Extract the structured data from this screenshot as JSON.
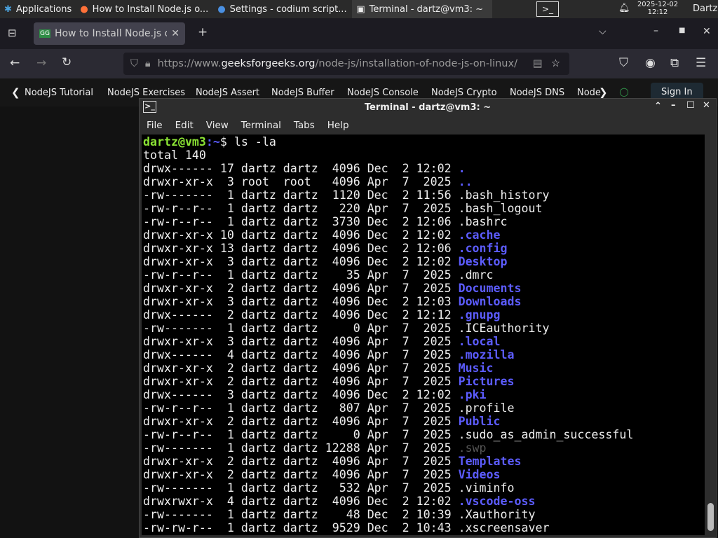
{
  "panel": {
    "apps": "Applications",
    "tasks": [
      "How to Install Node.js o...",
      "Settings - codium script...",
      "Terminal - dartz@vm3: ~"
    ],
    "date": "2025-12-02",
    "time": "12:12",
    "user": "Dartz"
  },
  "browser": {
    "tab_title": "How to Install Node.js on",
    "url_prefix": "https://www.",
    "url_domain": "geeksforgeeks.org",
    "url_path": "/node-js/installation-of-node-js-on-linux/",
    "site_nav": [
      "NodeJS Tutorial",
      "NodeJS Exercises",
      "NodeJS Assert",
      "NodeJS Buffer",
      "NodeJS Console",
      "NodeJS Crypto",
      "NodeJS DNS",
      "Node"
    ],
    "sign_in": "Sign In"
  },
  "terminal": {
    "title": "Terminal - dartz@vm3: ~",
    "menu": [
      "File",
      "Edit",
      "View",
      "Terminal",
      "Tabs",
      "Help"
    ],
    "prompt_user": "dartz@vm3",
    "prompt_path": ":~",
    "prompt_symbol": "$ ",
    "command": "ls -la",
    "total": "total 140",
    "lines": [
      {
        "meta": "drwx------ 17 dartz dartz  4096 Dec  2 12:02 ",
        "name": ".",
        "kind": "dir"
      },
      {
        "meta": "drwxr-xr-x  3 root  root   4096 Apr  7  2025 ",
        "name": "..",
        "kind": "dir"
      },
      {
        "meta": "-rw-------  1 dartz dartz  1120 Dec  2 11:56 ",
        "name": ".bash_history",
        "kind": "file"
      },
      {
        "meta": "-rw-r--r--  1 dartz dartz   220 Apr  7  2025 ",
        "name": ".bash_logout",
        "kind": "file"
      },
      {
        "meta": "-rw-r--r--  1 dartz dartz  3730 Dec  2 12:06 ",
        "name": ".bashrc",
        "kind": "file"
      },
      {
        "meta": "drwxr-xr-x 10 dartz dartz  4096 Dec  2 12:02 ",
        "name": ".cache",
        "kind": "dir"
      },
      {
        "meta": "drwxr-xr-x 13 dartz dartz  4096 Dec  2 12:06 ",
        "name": ".config",
        "kind": "dir"
      },
      {
        "meta": "drwxr-xr-x  3 dartz dartz  4096 Dec  2 12:02 ",
        "name": "Desktop",
        "kind": "dir"
      },
      {
        "meta": "-rw-r--r--  1 dartz dartz    35 Apr  7  2025 ",
        "name": ".dmrc",
        "kind": "file"
      },
      {
        "meta": "drwxr-xr-x  2 dartz dartz  4096 Apr  7  2025 ",
        "name": "Documents",
        "kind": "dir"
      },
      {
        "meta": "drwxr-xr-x  3 dartz dartz  4096 Dec  2 12:03 ",
        "name": "Downloads",
        "kind": "dir"
      },
      {
        "meta": "drwx------  2 dartz dartz  4096 Dec  2 12:12 ",
        "name": ".gnupg",
        "kind": "dir"
      },
      {
        "meta": "-rw-------  1 dartz dartz     0 Apr  7  2025 ",
        "name": ".ICEauthority",
        "kind": "file"
      },
      {
        "meta": "drwxr-xr-x  3 dartz dartz  4096 Apr  7  2025 ",
        "name": ".local",
        "kind": "dir"
      },
      {
        "meta": "drwx------  4 dartz dartz  4096 Apr  7  2025 ",
        "name": ".mozilla",
        "kind": "dir"
      },
      {
        "meta": "drwxr-xr-x  2 dartz dartz  4096 Apr  7  2025 ",
        "name": "Music",
        "kind": "dir"
      },
      {
        "meta": "drwxr-xr-x  2 dartz dartz  4096 Apr  7  2025 ",
        "name": "Pictures",
        "kind": "dir"
      },
      {
        "meta": "drwx------  3 dartz dartz  4096 Dec  2 12:02 ",
        "name": ".pki",
        "kind": "dir"
      },
      {
        "meta": "-rw-r--r--  1 dartz dartz   807 Apr  7  2025 ",
        "name": ".profile",
        "kind": "file"
      },
      {
        "meta": "drwxr-xr-x  2 dartz dartz  4096 Apr  7  2025 ",
        "name": "Public",
        "kind": "dir"
      },
      {
        "meta": "-rw-r--r--  1 dartz dartz     0 Apr  7  2025 ",
        "name": ".sudo_as_admin_successful",
        "kind": "file"
      },
      {
        "meta": "-rw-------  1 dartz dartz 12288 Apr  7  2025 ",
        "name": ".swp",
        "kind": "dim"
      },
      {
        "meta": "drwxr-xr-x  2 dartz dartz  4096 Apr  7  2025 ",
        "name": "Templates",
        "kind": "dir"
      },
      {
        "meta": "drwxr-xr-x  2 dartz dartz  4096 Apr  7  2025 ",
        "name": "Videos",
        "kind": "dir"
      },
      {
        "meta": "-rw-------  1 dartz dartz   532 Apr  7  2025 ",
        "name": ".viminfo",
        "kind": "file"
      },
      {
        "meta": "drwxrwxr-x  4 dartz dartz  4096 Dec  2 12:02 ",
        "name": ".vscode-oss",
        "kind": "dir"
      },
      {
        "meta": "-rw-------  1 dartz dartz    48 Dec  2 10:39 ",
        "name": ".Xauthority",
        "kind": "file"
      },
      {
        "meta": "-rw-rw-r--  1 dartz dartz  9529 Dec  2 10:43 ",
        "name": ".xscreensaver",
        "kind": "file"
      }
    ]
  },
  "colors": {
    "dir": "#5c5cff",
    "prompt_user": "#8ae234",
    "terminal_bg": "#000000"
  }
}
